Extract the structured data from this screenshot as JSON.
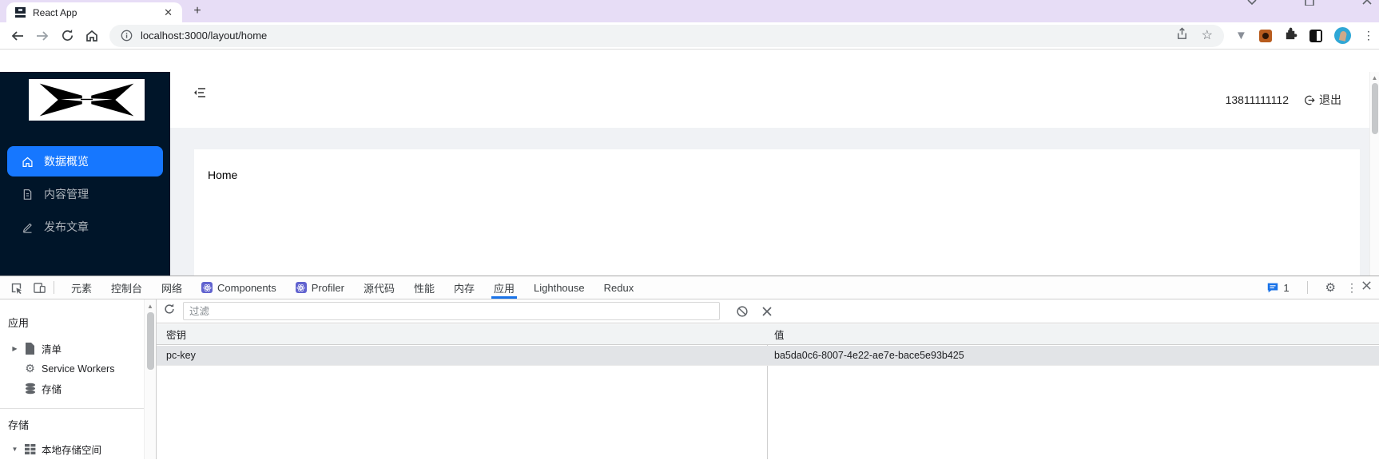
{
  "browser": {
    "tab_title": "React App",
    "tab_close": "✕",
    "new_tab_label": "+",
    "url": "localhost:3000/layout/home",
    "star_icon": "☆"
  },
  "app": {
    "sidebar": {
      "items": [
        {
          "label": "数据概览",
          "active": true
        },
        {
          "label": "内容管理",
          "active": false
        },
        {
          "label": "发布文章",
          "active": false
        }
      ]
    },
    "header": {
      "phone": "13811111112",
      "logout_label": "退出"
    },
    "content": {
      "title": "Home"
    }
  },
  "devtools": {
    "tabs": [
      {
        "label": "元素"
      },
      {
        "label": "控制台"
      },
      {
        "label": "网络"
      },
      {
        "label": "Components"
      },
      {
        "label": "Profiler"
      },
      {
        "label": "源代码"
      },
      {
        "label": "性能"
      },
      {
        "label": "内存"
      },
      {
        "label": "应用"
      },
      {
        "label": "Lighthouse"
      },
      {
        "label": "Redux"
      }
    ],
    "console_badge_count": "1",
    "sidebar": {
      "section_application": "应用",
      "manifest": "清单",
      "service_workers": "Service Workers",
      "storage_item": "存储",
      "section_storage": "存储",
      "local_storage": "本地存储空间",
      "expand_arrow": "▶",
      "collapse_arrow": "▼"
    },
    "filter_placeholder": "过滤",
    "table": {
      "col_key": "密钥",
      "col_value": "值",
      "rows": [
        {
          "key": "pc-key",
          "value": "ba5da0c6-8007-4e22-ae7e-bace5e93b425"
        }
      ]
    },
    "scroll_up_arrow": "▲"
  },
  "colors": {
    "tabstrip_bg": "#e7ddf6",
    "sidebar_bg": "#001529",
    "menu_active": "#1677ff",
    "devtools_accent": "#1a73e8",
    "selected_row_bg": "#e2e4e7"
  }
}
